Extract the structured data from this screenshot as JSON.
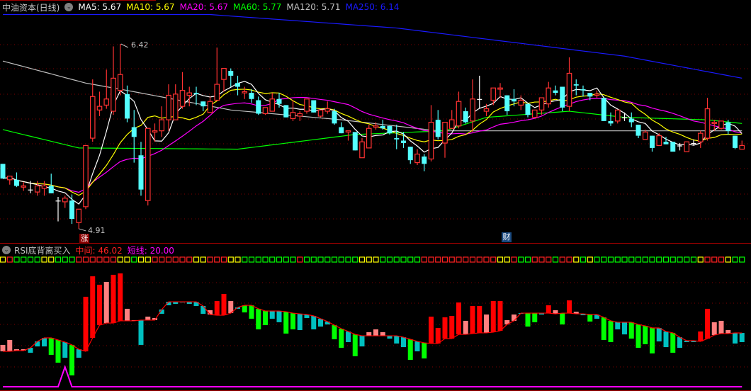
{
  "header": {
    "title": "中油资本(日线)",
    "ma": [
      {
        "label": "MA5: 5.67",
        "color": "#ffffff"
      },
      {
        "label": "MA10: 5.67",
        "color": "#ffff00"
      },
      {
        "label": "MA20: 5.67",
        "color": "#ff00ff"
      },
      {
        "label": "MA60: 5.77",
        "color": "#00ff00"
      },
      {
        "label": "MA120: 5.71",
        "color": "#c0c0c0"
      },
      {
        "label": "MA250: 6.14",
        "color": "#1a1aff"
      }
    ]
  },
  "annotations": {
    "high_label": "6.42",
    "low_label": "4.91",
    "zhang_badge": "涨",
    "cai_badge": "财"
  },
  "indicator": {
    "name": "RSI底背离买入",
    "middle_label": "中间: 46.02",
    "short_label": "短线: 20.00"
  },
  "colors": {
    "up": "#ff3232",
    "down": "#54ffff",
    "doji": "#ffffff",
    "hist_red": "#ff0000",
    "hist_pink": "#ff8080",
    "hist_green": "#00ff00",
    "hist_cyan": "#00c0c0",
    "mid_line": "#ff0000",
    "short_line": "#ff00ff",
    "grid": "#800000",
    "sq_r": "#ff2020",
    "sq_g": "#00ff00",
    "sq_y": "#ffff00"
  },
  "chart_data": [
    {
      "type": "candlestick",
      "title": "中油资本(日线)",
      "ylim": [
        4.91,
        6.42
      ],
      "ohlc": [
        [
          5.44,
          5.44,
          5.32,
          5.32
        ],
        [
          5.31,
          5.34,
          5.27,
          5.34
        ],
        [
          5.31,
          5.37,
          5.25,
          5.26
        ],
        [
          5.25,
          5.29,
          5.22,
          5.26
        ],
        [
          5.23,
          5.3,
          5.2,
          5.23
        ],
        [
          5.21,
          5.3,
          5.18,
          5.26
        ],
        [
          5.24,
          5.3,
          5.18,
          5.26
        ],
        [
          5.26,
          5.36,
          5.2,
          5.2
        ],
        [
          5.14,
          5.17,
          4.97,
          5.14
        ],
        [
          5.13,
          5.18,
          5.08,
          5.16
        ],
        [
          5.14,
          5.19,
          4.95,
          4.99
        ],
        [
          4.96,
          5.07,
          4.91,
          5.07
        ],
        [
          5.09,
          5.59,
          5.07,
          5.59
        ],
        [
          5.65,
          6.13,
          5.62,
          5.99
        ],
        [
          5.88,
          6.03,
          5.83,
          5.91
        ],
        [
          5.92,
          6.21,
          5.89,
          5.97
        ],
        [
          5.87,
          6.4,
          5.84,
          6.14
        ],
        [
          6.04,
          6.42,
          6.0,
          6.17
        ],
        [
          6.01,
          6.08,
          5.78,
          5.81
        ],
        [
          5.74,
          5.88,
          5.45,
          5.66
        ],
        [
          5.51,
          5.62,
          5.18,
          5.23
        ],
        [
          5.14,
          5.73,
          5.1,
          5.73
        ],
        [
          5.7,
          5.77,
          5.62,
          5.71
        ],
        [
          5.71,
          5.91,
          5.66,
          5.8
        ],
        [
          5.8,
          6.09,
          5.71,
          6.0
        ],
        [
          5.8,
          6.09,
          5.8,
          6.01
        ],
        [
          5.91,
          6.19,
          5.89,
          6.04
        ],
        [
          6.0,
          6.07,
          5.91,
          6.02
        ],
        [
          6.02,
          6.07,
          5.92,
          6.01
        ],
        [
          5.95,
          5.95,
          5.87,
          5.91
        ],
        [
          5.86,
          5.99,
          5.86,
          5.95
        ],
        [
          5.96,
          6.39,
          5.96,
          6.09
        ],
        [
          6.13,
          6.22,
          6.03,
          6.22
        ],
        [
          6.2,
          6.22,
          6.07,
          6.16
        ],
        [
          6.1,
          6.16,
          6.0,
          6.07
        ],
        [
          6.02,
          6.07,
          5.97,
          6.03
        ],
        [
          6.02,
          6.05,
          5.94,
          5.97
        ],
        [
          5.96,
          5.99,
          5.84,
          5.85
        ],
        [
          5.85,
          5.9,
          5.84,
          5.9
        ],
        [
          5.87,
          6.02,
          5.87,
          5.97
        ],
        [
          5.97,
          6.02,
          5.9,
          5.93
        ],
        [
          5.92,
          5.92,
          5.82,
          5.82
        ],
        [
          5.81,
          5.96,
          5.79,
          5.86
        ],
        [
          5.83,
          5.87,
          5.79,
          5.85
        ],
        [
          5.87,
          5.97,
          5.85,
          5.97
        ],
        [
          5.96,
          5.96,
          5.86,
          5.86
        ],
        [
          5.83,
          5.88,
          5.82,
          5.88
        ],
        [
          5.87,
          5.95,
          5.85,
          5.89
        ],
        [
          5.87,
          5.89,
          5.76,
          5.77
        ],
        [
          5.74,
          5.78,
          5.69,
          5.69
        ],
        [
          5.7,
          5.71,
          5.63,
          5.71
        ],
        [
          5.7,
          5.7,
          5.55,
          5.55
        ],
        [
          5.49,
          5.65,
          5.49,
          5.62
        ],
        [
          5.57,
          5.76,
          5.57,
          5.73
        ],
        [
          5.74,
          5.78,
          5.72,
          5.75
        ],
        [
          5.75,
          5.8,
          5.72,
          5.73
        ],
        [
          5.75,
          5.75,
          5.68,
          5.69
        ],
        [
          5.65,
          5.76,
          5.56,
          5.64
        ],
        [
          5.63,
          5.7,
          5.57,
          5.61
        ],
        [
          5.58,
          5.58,
          5.44,
          5.47
        ],
        [
          5.45,
          5.56,
          5.43,
          5.52
        ],
        [
          5.5,
          5.52,
          5.38,
          5.44
        ],
        [
          5.48,
          5.92,
          5.46,
          5.78
        ],
        [
          5.8,
          5.88,
          5.64,
          5.66
        ],
        [
          5.61,
          5.78,
          5.49,
          5.78
        ],
        [
          5.73,
          5.88,
          5.73,
          5.8
        ],
        [
          5.75,
          6.03,
          5.73,
          5.95
        ],
        [
          5.87,
          5.9,
          5.77,
          5.78
        ],
        [
          5.79,
          6.13,
          5.7,
          5.97
        ],
        [
          5.97,
          6.16,
          5.89,
          5.97
        ],
        [
          5.87,
          5.93,
          5.83,
          5.89
        ],
        [
          5.96,
          6.06,
          5.92,
          6.06
        ],
        [
          6.05,
          6.1,
          5.98,
          6.06
        ],
        [
          6.0,
          6.0,
          5.84,
          5.87
        ],
        [
          5.97,
          6.05,
          5.91,
          5.95
        ],
        [
          5.92,
          6.0,
          5.88,
          5.96
        ],
        [
          5.93,
          5.93,
          5.82,
          5.84
        ],
        [
          5.82,
          5.88,
          5.82,
          5.88
        ],
        [
          5.88,
          5.98,
          5.84,
          5.98
        ],
        [
          5.93,
          6.11,
          5.9,
          6.06
        ],
        [
          6.04,
          6.08,
          6.0,
          6.02
        ],
        [
          6.07,
          6.07,
          5.87,
          5.9
        ],
        [
          5.91,
          6.31,
          5.87,
          6.18
        ],
        [
          6.09,
          6.13,
          6.0,
          6.08
        ],
        [
          6.05,
          6.08,
          5.99,
          6.04
        ],
        [
          6.02,
          6.02,
          5.96,
          5.99
        ],
        [
          6.0,
          6.04,
          5.98,
          6.01
        ],
        [
          5.98,
          5.98,
          5.79,
          5.79
        ],
        [
          5.79,
          5.86,
          5.75,
          5.77
        ],
        [
          5.79,
          5.88,
          5.77,
          5.88
        ],
        [
          5.82,
          5.86,
          5.79,
          5.82
        ],
        [
          5.81,
          5.86,
          5.74,
          5.78
        ],
        [
          5.76,
          5.76,
          5.65,
          5.67
        ],
        [
          5.64,
          5.72,
          5.64,
          5.7
        ],
        [
          5.67,
          5.67,
          5.54,
          5.57
        ],
        [
          5.59,
          5.69,
          5.59,
          5.67
        ],
        [
          5.62,
          5.66,
          5.6,
          5.6
        ],
        [
          5.62,
          5.62,
          5.54,
          5.54
        ],
        [
          5.59,
          5.61,
          5.55,
          5.59
        ],
        [
          5.54,
          5.62,
          5.54,
          5.62
        ],
        [
          5.61,
          5.64,
          5.59,
          5.61
        ],
        [
          5.62,
          5.71,
          5.57,
          5.69
        ],
        [
          5.65,
          5.98,
          5.63,
          5.89
        ],
        [
          5.77,
          5.8,
          5.71,
          5.78
        ],
        [
          5.73,
          5.79,
          5.72,
          5.79
        ],
        [
          5.78,
          5.8,
          5.68,
          5.71
        ],
        [
          5.67,
          5.67,
          5.56,
          5.57
        ],
        [
          5.56,
          5.63,
          5.56,
          5.59
        ]
      ],
      "ma_computed": [
        5,
        10,
        20
      ],
      "ma_long": {
        "MA60": [
          [
            0,
            5.72
          ],
          [
            11,
            5.57
          ],
          [
            34,
            5.56
          ],
          [
            51,
            5.68
          ],
          [
            64,
            5.71
          ],
          [
            70,
            5.82
          ],
          [
            82,
            5.87
          ],
          [
            90,
            5.82
          ],
          [
            102,
            5.8
          ],
          [
            107,
            5.77
          ]
        ],
        "MA120": [
          [
            0,
            6.28
          ],
          [
            12,
            6.1
          ],
          [
            18,
            6.04
          ],
          [
            33,
            5.88
          ],
          [
            49,
            5.8
          ],
          [
            63,
            5.71
          ],
          [
            107,
            5.71
          ]
        ],
        "MA250": [
          [
            0,
            6.66
          ],
          [
            30,
            6.66
          ],
          [
            57,
            6.55
          ],
          [
            90,
            6.32
          ],
          [
            107,
            6.14
          ]
        ]
      },
      "high": {
        "bar": 17,
        "value": 6.42
      },
      "low": {
        "bar": 11,
        "value": 4.91
      }
    },
    {
      "type": "bar",
      "title": "RSI底背离买入",
      "ylim": [
        0,
        100
      ],
      "histogram_line_bar_color": [
        [
          30.3,
          35.8,
          "p"
        ],
        [
          30.3,
          40.0,
          "p"
        ],
        [
          30.9,
          32.1,
          "p"
        ],
        [
          30.9,
          32.1,
          "p"
        ],
        [
          33.3,
          29.1,
          "c"
        ],
        [
          38.8,
          34.5,
          "c"
        ],
        [
          41.8,
          34.5,
          "c"
        ],
        [
          41.8,
          27.3,
          "g"
        ],
        [
          40.0,
          20.6,
          "g"
        ],
        [
          38.2,
          24.8,
          "c"
        ],
        [
          35.8,
          9.7,
          "g"
        ],
        [
          32.1,
          24.8,
          "c"
        ],
        [
          30.3,
          77.0,
          "r"
        ],
        [
          41.8,
          94.5,
          "r"
        ],
        [
          52.7,
          87.3,
          "r"
        ],
        [
          54.5,
          89.7,
          "p"
        ],
        [
          54.5,
          95.8,
          "r"
        ],
        [
          56.4,
          97.0,
          "r"
        ],
        [
          56.4,
          66.7,
          "p"
        ],
        [
          56.4,
          57.0,
          "p"
        ],
        [
          57.0,
          35.8,
          "c"
        ],
        [
          57.0,
          60.0,
          "p"
        ],
        [
          57.0,
          58.8,
          "p"
        ],
        [
          66.1,
          62.4,
          "c"
        ],
        [
          72.7,
          69.7,
          "c"
        ],
        [
          72.7,
          70.9,
          "c"
        ],
        [
          72.7,
          72.1,
          "c"
        ],
        [
          72.7,
          70.9,
          "c"
        ],
        [
          72.7,
          69.1,
          "c"
        ],
        [
          69.1,
          62.4,
          "c"
        ],
        [
          61.8,
          65.5,
          "p"
        ],
        [
          61.2,
          73.3,
          "r"
        ],
        [
          61.2,
          79.4,
          "r"
        ],
        [
          63.0,
          73.3,
          "p"
        ],
        [
          67.9,
          66.7,
          "c"
        ],
        [
          69.7,
          63.6,
          "g"
        ],
        [
          69.7,
          58.2,
          "g"
        ],
        [
          66.7,
          49.1,
          "g"
        ],
        [
          64.8,
          52.7,
          "g"
        ],
        [
          64.8,
          58.2,
          "c"
        ],
        [
          64.8,
          55.2,
          "c"
        ],
        [
          64.2,
          45.5,
          "g"
        ],
        [
          63.0,
          49.1,
          "g"
        ],
        [
          62.4,
          48.5,
          "c"
        ],
        [
          61.8,
          58.8,
          "c"
        ],
        [
          60.6,
          49.1,
          "c"
        ],
        [
          58.2,
          51.5,
          "c"
        ],
        [
          55.8,
          53.3,
          "c"
        ],
        [
          52.7,
          40.6,
          "g"
        ],
        [
          49.7,
          33.3,
          "g"
        ],
        [
          47.3,
          38.2,
          "c"
        ],
        [
          44.8,
          26.1,
          "g"
        ],
        [
          43.6,
          34.5,
          "c"
        ],
        [
          43.6,
          46.7,
          "p"
        ],
        [
          43.6,
          49.1,
          "p"
        ],
        [
          43.6,
          46.7,
          "p"
        ],
        [
          43.6,
          41.2,
          "c"
        ],
        [
          43.6,
          37.0,
          "c"
        ],
        [
          42.4,
          33.9,
          "c"
        ],
        [
          40.6,
          23.0,
          "g"
        ],
        [
          38.8,
          30.3,
          "c"
        ],
        [
          37.6,
          24.2,
          "g"
        ],
        [
          37.0,
          60.0,
          "r"
        ],
        [
          37.0,
          50.3,
          "r"
        ],
        [
          41.2,
          59.4,
          "r"
        ],
        [
          41.2,
          60.6,
          "r"
        ],
        [
          44.8,
          72.1,
          "r"
        ],
        [
          44.8,
          56.4,
          "p"
        ],
        [
          45.5,
          69.1,
          "r"
        ],
        [
          46.1,
          69.1,
          "r"
        ],
        [
          46.1,
          61.8,
          "p"
        ],
        [
          46.7,
          73.3,
          "r"
        ],
        [
          47.9,
          73.3,
          "r"
        ],
        [
          53.3,
          57.0,
          "p"
        ],
        [
          56.4,
          61.8,
          "p"
        ],
        [
          63.0,
          62.4,
          "c"
        ],
        [
          63.0,
          51.5,
          "g"
        ],
        [
          63.0,
          55.2,
          "g"
        ],
        [
          63.0,
          61.8,
          "c"
        ],
        [
          63.0,
          69.7,
          "r"
        ],
        [
          62.4,
          65.5,
          "p"
        ],
        [
          63.0,
          53.3,
          "g"
        ],
        [
          63.0,
          73.9,
          "r"
        ],
        [
          62.4,
          64.2,
          "p"
        ],
        [
          62.4,
          61.2,
          "c"
        ],
        [
          61.8,
          55.8,
          "g"
        ],
        [
          61.8,
          58.2,
          "c"
        ],
        [
          59.4,
          40.0,
          "g"
        ],
        [
          56.4,
          38.2,
          "g"
        ],
        [
          55.2,
          49.1,
          "c"
        ],
        [
          55.2,
          44.8,
          "c"
        ],
        [
          55.2,
          41.2,
          "g"
        ],
        [
          53.3,
          33.3,
          "g"
        ],
        [
          52.1,
          36.4,
          "g"
        ],
        [
          50.3,
          28.5,
          "g"
        ],
        [
          50.3,
          38.8,
          "c"
        ],
        [
          47.3,
          33.9,
          "c"
        ],
        [
          46.1,
          29.1,
          "g"
        ],
        [
          42.4,
          33.3,
          "c"
        ],
        [
          39.4,
          38.2,
          "c"
        ],
        [
          39.4,
          38.2,
          "c"
        ],
        [
          38.8,
          47.3,
          "r"
        ],
        [
          41.2,
          66.7,
          "r"
        ],
        [
          44.2,
          55.2,
          "p"
        ],
        [
          45.5,
          56.4,
          "p"
        ],
        [
          45.5,
          48.5,
          "p"
        ],
        [
          46.1,
          37.0,
          "c"
        ],
        [
          46.02,
          38.2,
          "c"
        ]
      ],
      "short_line": {
        "baseline": 20.0,
        "spike_bar": 9,
        "spike_value": 100
      },
      "signal_squares": "yrggggyygggrrrrrryygyyrrrrrryyrrryyggggggggrggggggggyyyggggggrrrrrrrrrrryyrggrrrgrrygygggggggggggggggyrrrygg"
    }
  ]
}
